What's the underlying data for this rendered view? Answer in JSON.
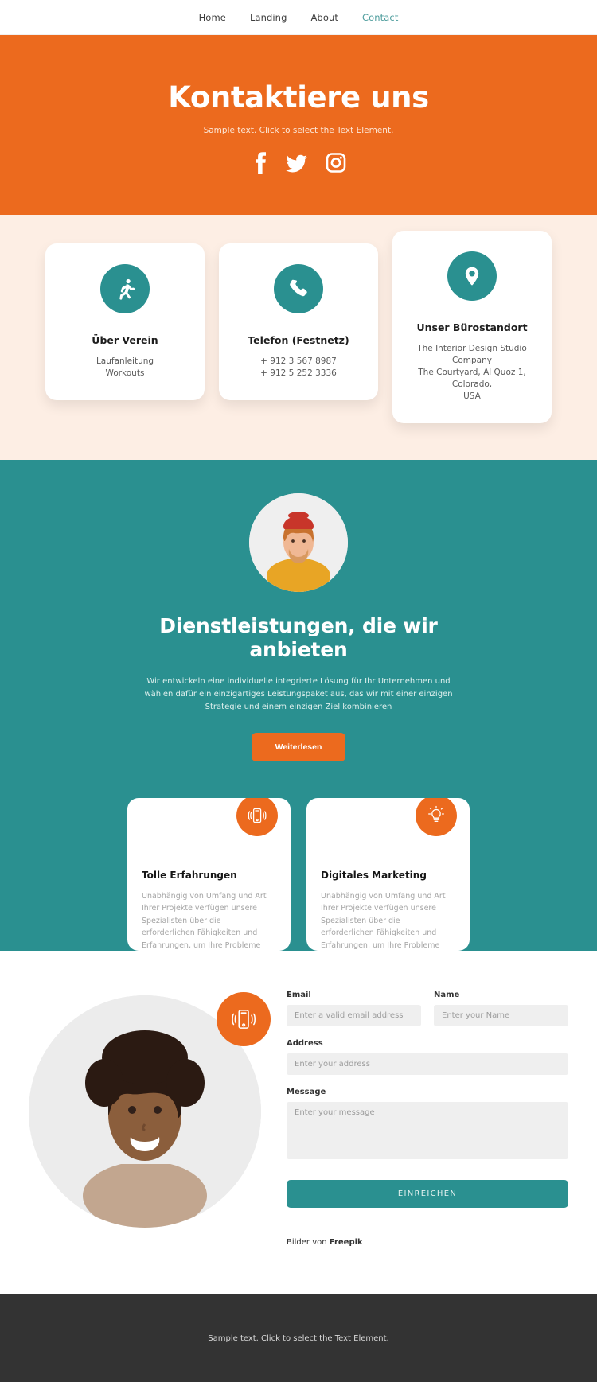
{
  "nav": {
    "items": [
      {
        "label": "Home",
        "active": false
      },
      {
        "label": "Landing",
        "active": false
      },
      {
        "label": "About",
        "active": false
      },
      {
        "label": "Contact",
        "active": true
      }
    ]
  },
  "hero": {
    "title": "Kontaktiere uns",
    "subtitle": "Sample text. Click to select the Text Element.",
    "background_color": "#ec6a1e",
    "socials": [
      {
        "name": "facebook-icon"
      },
      {
        "name": "twitter-icon"
      },
      {
        "name": "instagram-icon"
      }
    ]
  },
  "info_cards": [
    {
      "icon": "running-icon",
      "title": "Über Verein",
      "lines": [
        "Laufanleitung",
        "Workouts"
      ]
    },
    {
      "icon": "phone-icon",
      "title": "Telefon (Festnetz)",
      "lines": [
        "+ 912 3 567 8987",
        "+ 912 5 252 3336"
      ]
    },
    {
      "icon": "map-pin-icon",
      "title": "Unser Bürostandort",
      "lines": [
        "The Interior Design Studio Company",
        "The Courtyard, Al Quoz 1, Colorado,",
        "USA"
      ]
    }
  ],
  "services": {
    "title": "Dienstleistungen, die wir anbieten",
    "text": "Wir entwickeln eine individuelle integrierte Lösung für Ihr Unternehmen und wählen dafür ein einzigartiges Leistungspaket aus, das wir mit einer einzigen Strategie und einem einzigen Ziel kombinieren",
    "button_label": "Weiterlesen",
    "background_color": "#2a9090",
    "features": [
      {
        "icon": "mobile-vibrate-icon",
        "title": "Tolle Erfahrungen",
        "text": "Unabhängig von Umfang und Art Ihrer Projekte verfügen unsere Spezialisten über die erforderlichen Fähigkeiten und Erfahrungen, um Ihre Probleme erfolgreich zu lösen."
      },
      {
        "icon": "lightbulb-icon",
        "title": "Digitales Marketing",
        "text": "Unabhängig von Umfang und Art Ihrer Projekte verfügen unsere Spezialisten über die erforderlichen Fähigkeiten und Erfahrungen, um Ihre Probleme erfolgreich zu lösen."
      }
    ]
  },
  "contact": {
    "badge_icon": "mobile-vibrate-icon",
    "photo_alt": "portrait-photo",
    "fields": {
      "email": {
        "label": "Email",
        "placeholder": "Enter a valid email address",
        "value": ""
      },
      "name": {
        "label": "Name",
        "placeholder": "Enter your Name",
        "value": ""
      },
      "address": {
        "label": "Address",
        "placeholder": "Enter your address",
        "value": ""
      },
      "message": {
        "label": "Message",
        "placeholder": "Enter your message",
        "value": ""
      }
    },
    "submit_label": "EINREICHEN",
    "credit_prefix": "Bilder von ",
    "credit_source": "Freepik"
  },
  "footer": {
    "text": "Sample text. Click to select the Text Element.",
    "background_color": "#333333"
  }
}
